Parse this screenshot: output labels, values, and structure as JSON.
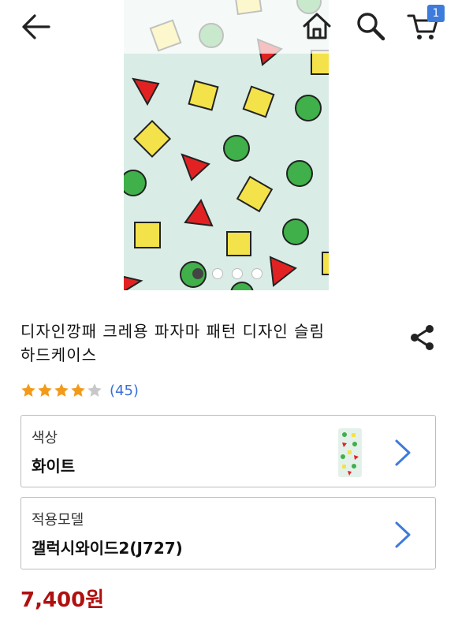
{
  "header": {
    "back_icon": "arrow-left-icon",
    "home_icon": "home-icon",
    "search_icon": "search-icon",
    "cart_icon": "shopping-cart-icon",
    "cart_count": "1"
  },
  "gallery": {
    "slide_count": 4,
    "active_slide": 1,
    "background": "#d9ece6"
  },
  "product": {
    "title_line1": "디자인깡패 크레용 파자마 패턴 디자인 슬림",
    "title_line2": "하드케이스",
    "rating": 4,
    "rating_max": 5,
    "review_count": "(45)",
    "price": "7,400원"
  },
  "options": {
    "color": {
      "label": "색상",
      "value": "화이트"
    },
    "model": {
      "label": "적용모델",
      "value": "갤럭시와이드2(J727)"
    }
  },
  "colors": {
    "accent": "#3a6fd8",
    "price": "#b01010",
    "star_filled": "#f39a1a",
    "star_empty": "#c8c8c8",
    "chevron": "#3d7bdc"
  }
}
